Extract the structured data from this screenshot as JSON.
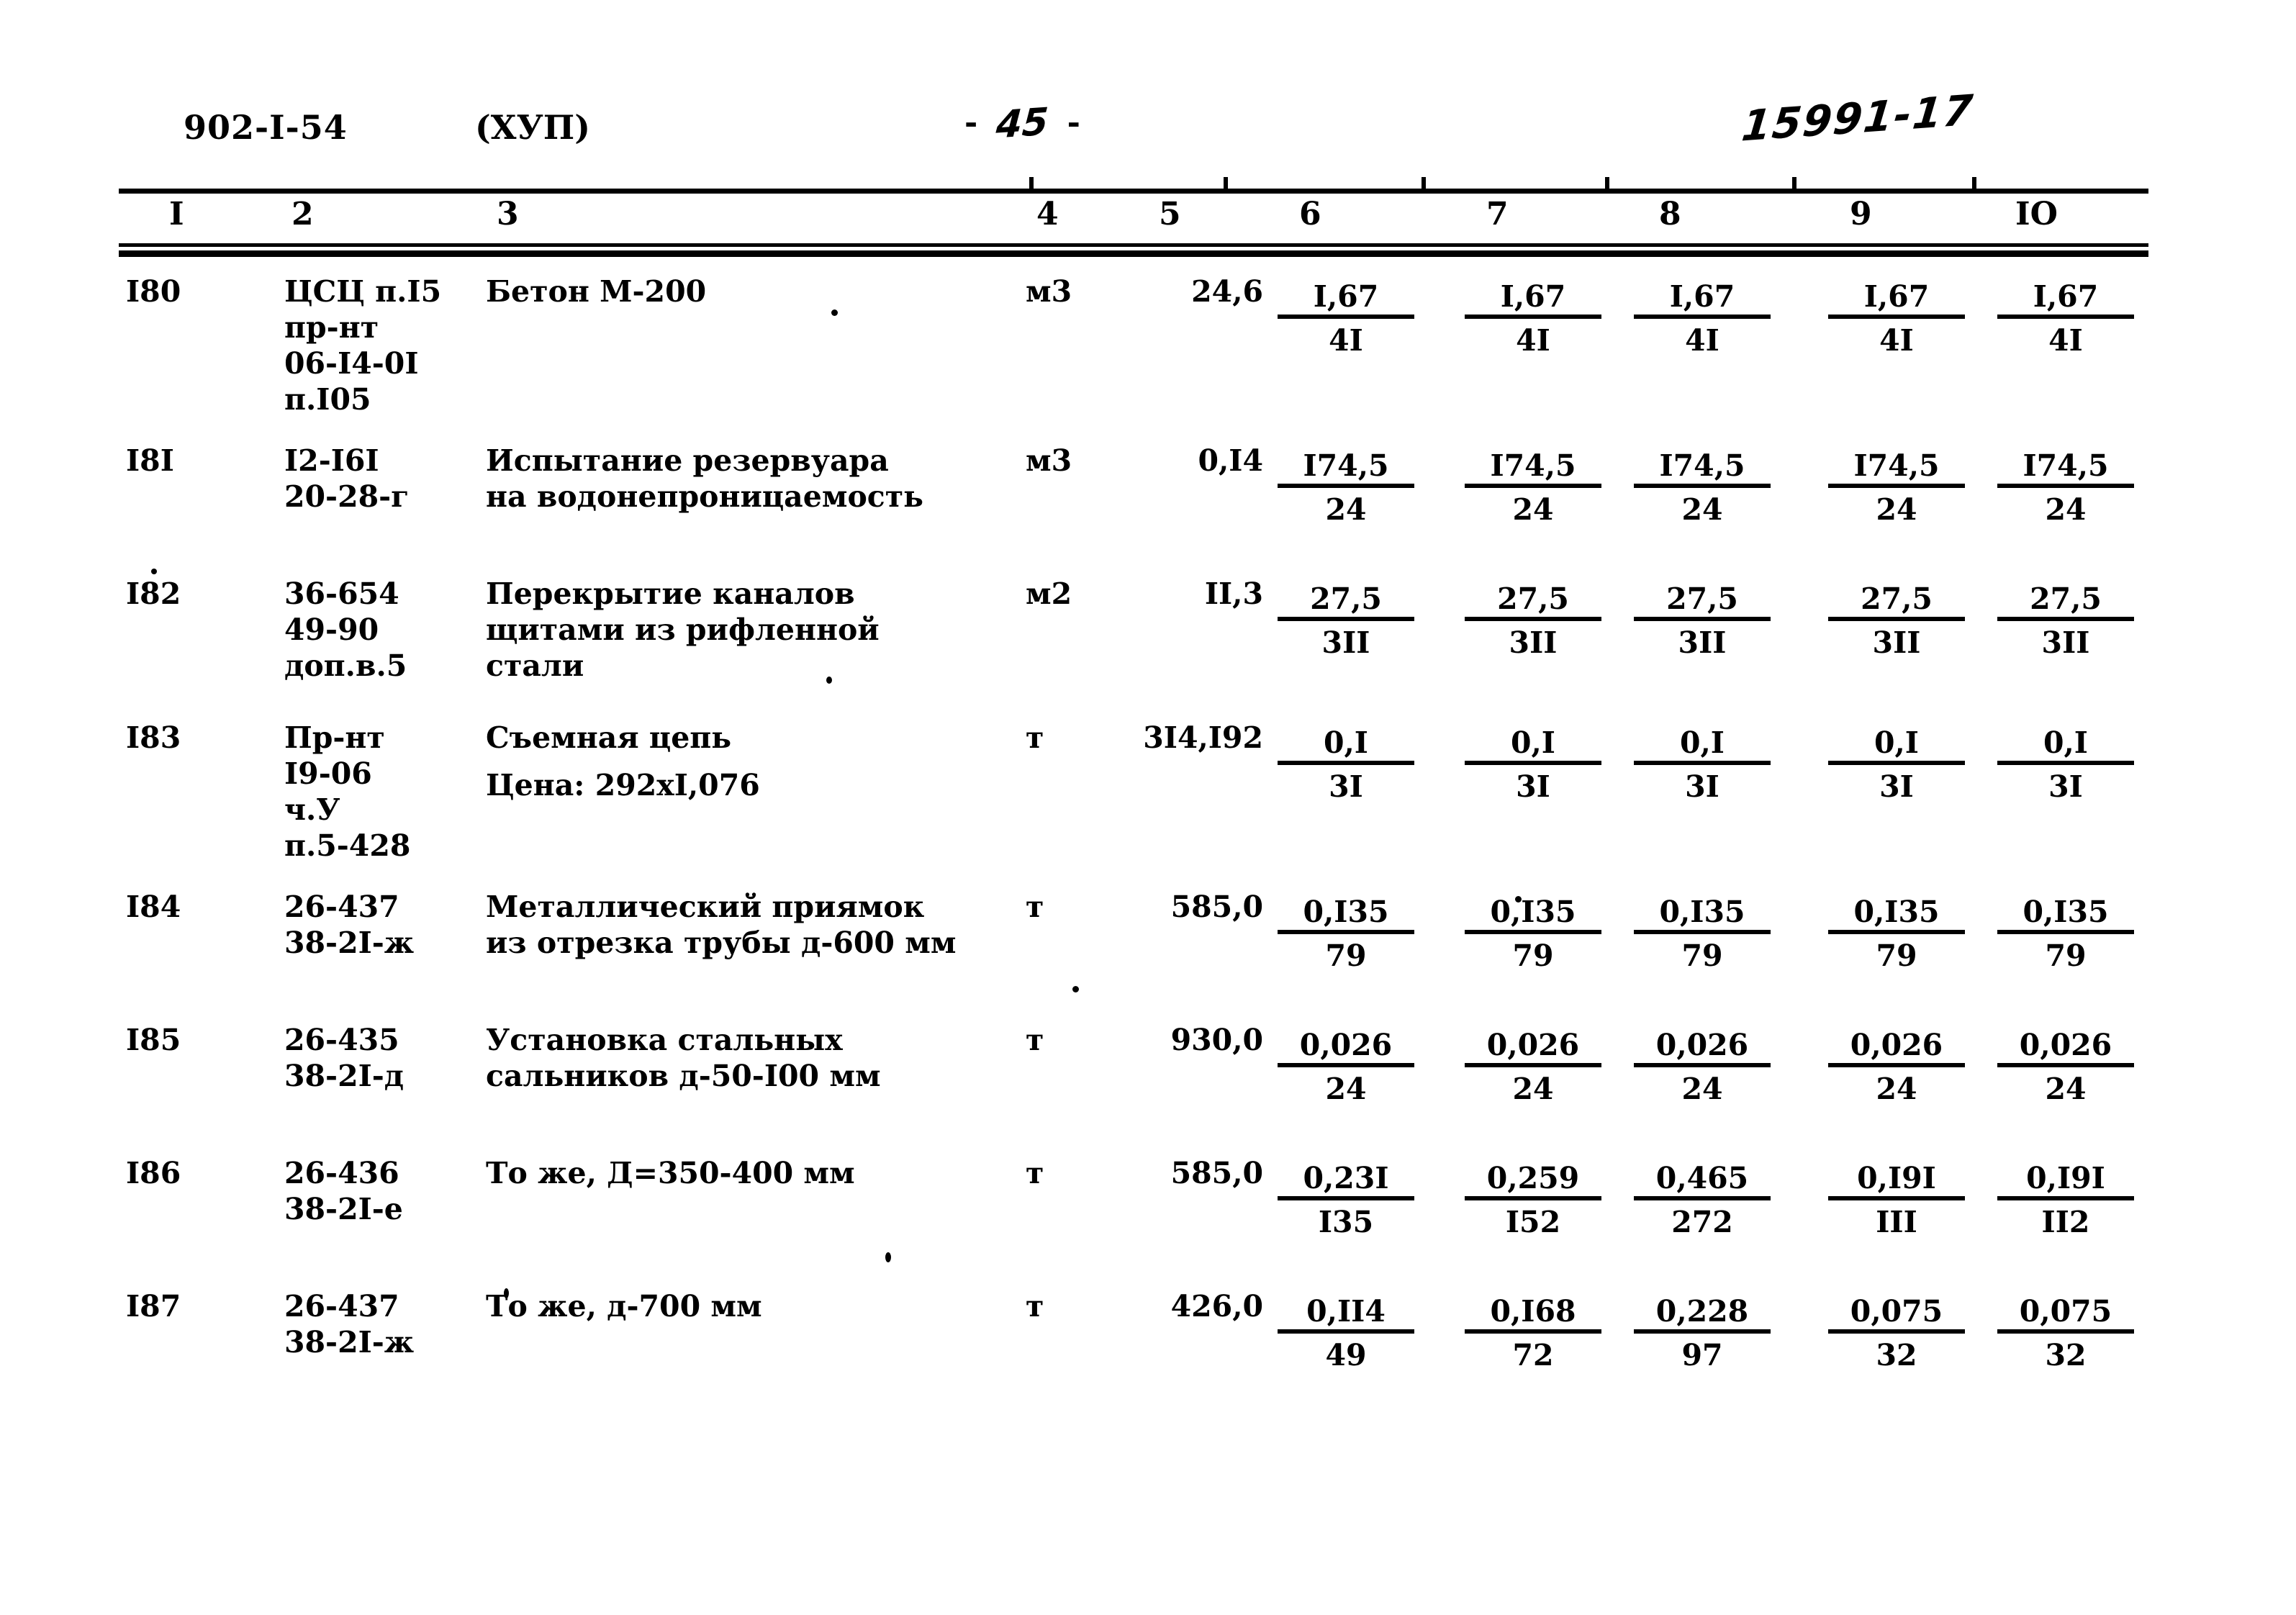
{
  "header": {
    "doc_code": "902-I-54",
    "part": "(ХУП)",
    "page_dash_left": "-",
    "page_number": "45",
    "page_dash_right": "-",
    "archive_stamp": "15991-17"
  },
  "column_headers": [
    "I",
    "2",
    "3",
    "4",
    "5",
    "6",
    "7",
    "8",
    "9",
    "IO"
  ],
  "rows": [
    {
      "no": "I80",
      "code": "ЦСЦ п.I5\nпр-нт\n06-I4-0I\nп.I05",
      "desc": "Бетон М-200",
      "desc2": "",
      "desc3": "",
      "unit": "м3",
      "qty": "24,6",
      "values": [
        {
          "num": "I,67",
          "den": "4I"
        },
        {
          "num": "I,67",
          "den": "4I"
        },
        {
          "num": "I,67",
          "den": "4I"
        },
        {
          "num": "I,67",
          "den": "4I"
        },
        {
          "num": "I,67",
          "den": "4I"
        }
      ]
    },
    {
      "no": "I8I",
      "code": "I2-I6I\n20-28-г",
      "desc": "Испытание резервуара",
      "desc2": "на водонепроницаемость",
      "desc3": "",
      "unit": "м3",
      "qty": "0,I4",
      "values": [
        {
          "num": "I74,5",
          "den": "24"
        },
        {
          "num": "I74,5",
          "den": "24"
        },
        {
          "num": "I74,5",
          "den": "24"
        },
        {
          "num": "I74,5",
          "den": "24"
        },
        {
          "num": "I74,5",
          "den": "24"
        }
      ]
    },
    {
      "no": "I82",
      "code": "36-654\n49-90\nдоп.в.5",
      "desc": "Перекрытие каналов",
      "desc2": "щитами из рифленной",
      "desc3": "стали",
      "unit": "м2",
      "qty": "II,3",
      "values": [
        {
          "num": "27,5",
          "den": "3II"
        },
        {
          "num": "27,5",
          "den": "3II"
        },
        {
          "num": "27,5",
          "den": "3II"
        },
        {
          "num": "27,5",
          "den": "3II"
        },
        {
          "num": "27,5",
          "den": "3II"
        }
      ]
    },
    {
      "no": "I83",
      "code": "Пр-нт\nI9-06\nч.У\nп.5-428",
      "desc": "Съемная цепь",
      "desc2": "Цена: 292хI,076",
      "desc3": "",
      "unit": "т",
      "qty": "3I4,I92",
      "values": [
        {
          "num": "0,I",
          "den": "3I"
        },
        {
          "num": "0,I",
          "den": "3I"
        },
        {
          "num": "0,I",
          "den": "3I"
        },
        {
          "num": "0,I",
          "den": "3I"
        },
        {
          "num": "0,I",
          "den": "3I"
        }
      ]
    },
    {
      "no": "I84",
      "code": "26-437\n38-2I-ж",
      "desc": "Металлический приямок",
      "desc2": "из отрезка трубы д-600 мм",
      "desc3": "",
      "unit": "т",
      "qty": "585,0",
      "values": [
        {
          "num": "0,I35",
          "den": "79"
        },
        {
          "num": "0,I35",
          "den": "79"
        },
        {
          "num": "0,I35",
          "den": "79"
        },
        {
          "num": "0,I35",
          "den": "79"
        },
        {
          "num": "0,I35",
          "den": "79"
        }
      ]
    },
    {
      "no": "I85",
      "code": "26-435\n38-2I-д",
      "desc": "Установка стальных",
      "desc2": "сальников д-50-I00 мм",
      "desc3": "",
      "unit": "т",
      "qty": "930,0",
      "values": [
        {
          "num": "0,026",
          "den": "24"
        },
        {
          "num": "0,026",
          "den": "24"
        },
        {
          "num": "0,026",
          "den": "24"
        },
        {
          "num": "0,026",
          "den": "24"
        },
        {
          "num": "0,026",
          "den": "24"
        }
      ]
    },
    {
      "no": "I86",
      "code": "26-436\n38-2I-е",
      "desc": "То же, Д=350-400 мм",
      "desc2": "",
      "desc3": "",
      "unit": "т",
      "qty": "585,0",
      "values": [
        {
          "num": "0,23I",
          "den": "I35"
        },
        {
          "num": "0,259",
          "den": "I52"
        },
        {
          "num": "0,465",
          "den": "272"
        },
        {
          "num": "0,I9I",
          "den": "III"
        },
        {
          "num": "0,I9I",
          "den": "II2"
        }
      ]
    },
    {
      "no": "I87",
      "code": "26-437\n38-2I-ж",
      "desc": "То же, д-700 мм",
      "desc2": "",
      "desc3": "",
      "unit": "т",
      "qty": "426,0",
      "values": [
        {
          "num": "0,II4",
          "den": "49"
        },
        {
          "num": "0,I68",
          "den": "72"
        },
        {
          "num": "0,228",
          "den": "97"
        },
        {
          "num": "0,075",
          "den": "32"
        },
        {
          "num": "0,075",
          "den": "32"
        }
      ]
    }
  ]
}
